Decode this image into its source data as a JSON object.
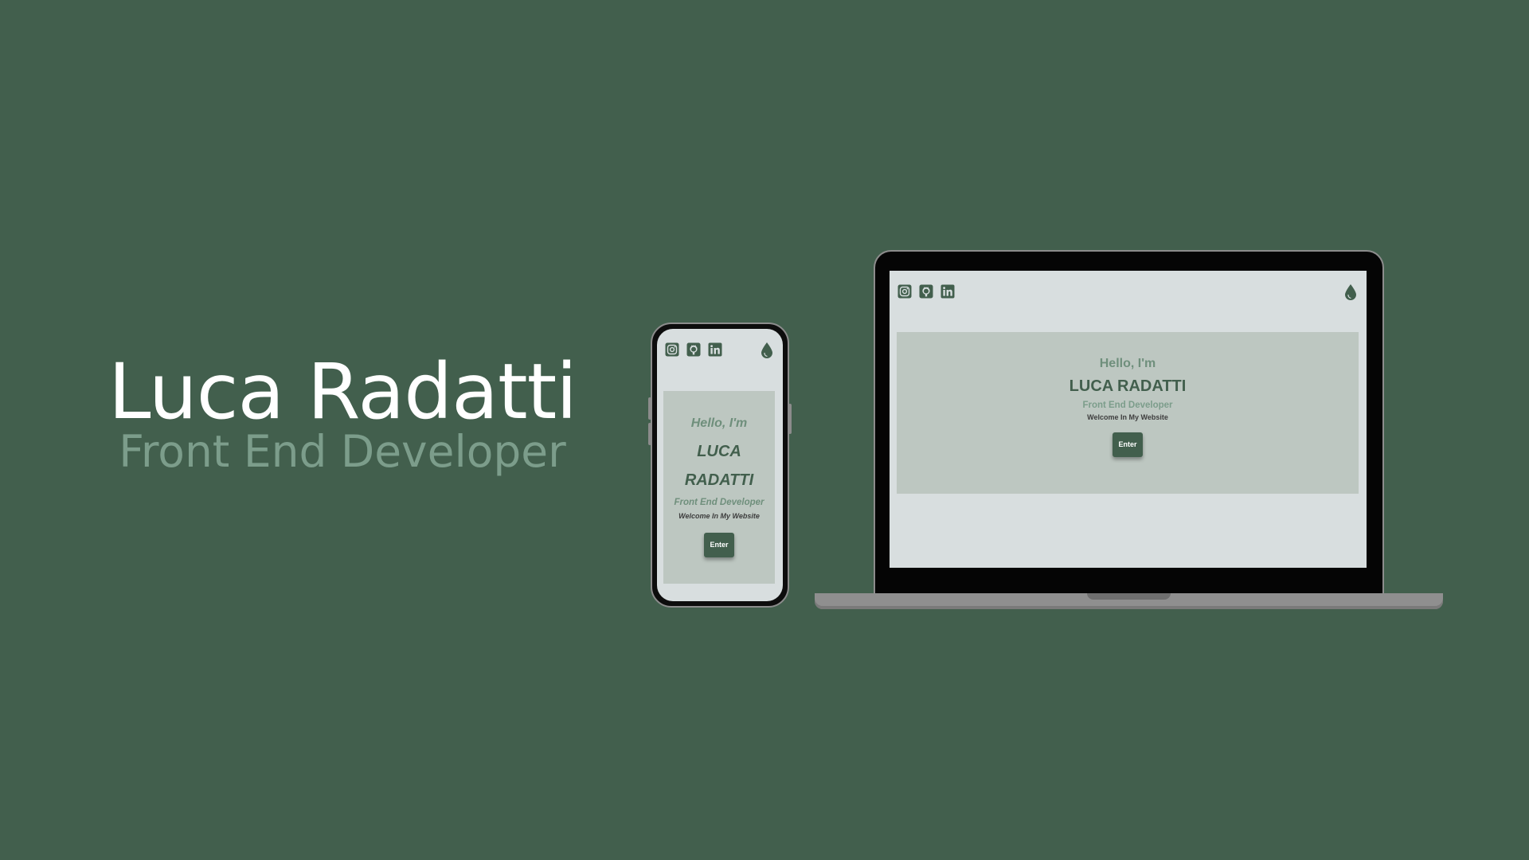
{
  "colors": {
    "background": "#425f4d",
    "accent": "#425f4d",
    "muted_green": "#7c9d8b",
    "screen_bg": "#d8dedf",
    "card_bg": "#bdc7c1",
    "device_frame": "#8c8c8c"
  },
  "hero": {
    "name": "Luca Radatti",
    "role": "Front End Developer"
  },
  "icons": {
    "instagram": "instagram-icon",
    "github": "github-icon",
    "linkedin": "linkedin-icon",
    "theme_toggle": "droplet-icon"
  },
  "phone": {
    "hello": "Hello, I'm",
    "name_line1": "LUCA",
    "name_line2": "RADATTI",
    "role": "Front End Developer",
    "welcome": "Welcome In My Website",
    "enter_label": "Enter"
  },
  "laptop": {
    "hello": "Hello, I'm",
    "name": "LUCA RADATTI",
    "role": "Front End Developer",
    "welcome": "Welcome In My Website",
    "enter_label": "Enter"
  }
}
